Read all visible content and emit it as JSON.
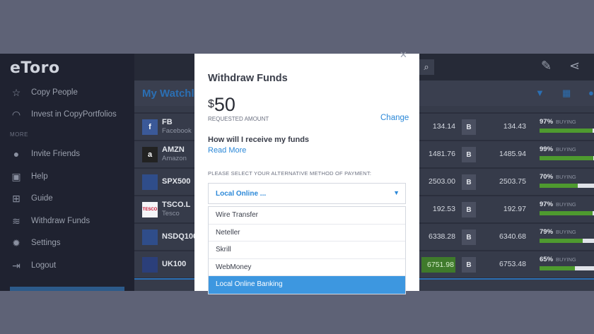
{
  "sidebar": {
    "logo": "eToro",
    "items": [
      {
        "label": "Copy People",
        "icon": "star-icon"
      },
      {
        "label": "Invest in CopyPortfolios",
        "icon": "portfolio-icon"
      }
    ],
    "more_label": "MORE",
    "more_items": [
      {
        "label": "Invite Friends",
        "icon": "invite-icon"
      },
      {
        "label": "Help",
        "icon": "help-icon"
      },
      {
        "label": "Guide",
        "icon": "guide-icon"
      },
      {
        "label": "Withdraw Funds",
        "icon": "withdraw-icon"
      },
      {
        "label": "Settings",
        "icon": "gear-icon"
      },
      {
        "label": "Logout",
        "icon": "logout-icon"
      }
    ]
  },
  "header": {
    "watchlist_title": "My Watchl"
  },
  "watchlist": {
    "rows": [
      {
        "symbol": "FB",
        "name": "Facebook",
        "logo": "f",
        "sell": "134.14",
        "buy": "134.43",
        "pct": "97%",
        "buying": "BUYING",
        "buying_pct": 97
      },
      {
        "symbol": "AMZN",
        "name": "Amazon",
        "logo": "a",
        "sell": "1481.76",
        "buy": "1485.94",
        "pct": "99%",
        "buying": "BUYING",
        "buying_pct": 99
      },
      {
        "symbol": "SPX500",
        "name": "",
        "logo": "",
        "sell": "2503.00",
        "buy": "2503.75",
        "pct": "70%",
        "buying": "BUYING",
        "buying_pct": 70
      },
      {
        "symbol": "TSCO.L",
        "name": "Tesco",
        "logo": "",
        "sell": "192.53",
        "buy": "192.97",
        "pct": "97%",
        "buying": "BUYING",
        "buying_pct": 97
      },
      {
        "symbol": "NSDQ100",
        "name": "",
        "logo": "",
        "sell": "6338.28",
        "buy": "6340.68",
        "pct": "79%",
        "buying": "BUYING",
        "buying_pct": 79
      },
      {
        "symbol": "UK100",
        "name": "",
        "logo": "",
        "sell": "6751.98",
        "buy": "6753.48",
        "pct": "65%",
        "buying": "BUYING",
        "buying_pct": 65
      }
    ],
    "buy_button_label": "B"
  },
  "modal": {
    "title": "Withdraw Funds",
    "currency": "$",
    "amount": "50",
    "requested_label": "REQUESTED AMOUNT",
    "change_label": "Change",
    "how_label": "How will I receive my funds",
    "read_more": "Read More",
    "select_label": "PLEASE SELECT YOUR ALTERNATIVE METHOD OF PAYMENT:",
    "selected_value": "Local Online ...",
    "options": [
      "Wire Transfer",
      "Neteller",
      "Skrill",
      "WebMoney",
      "Local Online Banking"
    ],
    "highlighted_option": "Local Online Banking"
  },
  "colors": {
    "accent": "#2b88d8",
    "highlight": "#3d97e0",
    "buying_bar": "#4e9a2f"
  }
}
